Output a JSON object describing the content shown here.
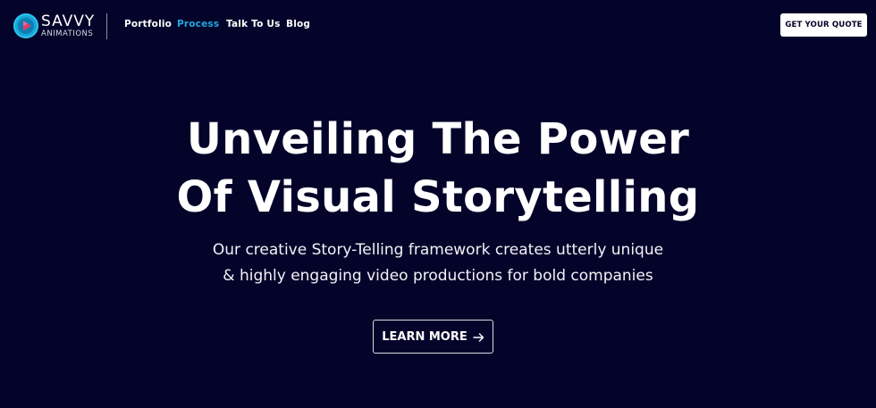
{
  "header": {
    "logo": {
      "name": "SAVVY",
      "tagline": "ANIMATIONS",
      "icon": "play-icon",
      "color": "#16a6d8"
    },
    "nav": [
      {
        "label": "Portfolio",
        "active": false
      },
      {
        "label": "Process",
        "active": true
      },
      {
        "label": "Talk To Us",
        "active": false
      },
      {
        "label": "Blog",
        "active": false
      }
    ],
    "cta_label": "GET YOUR QUOTE"
  },
  "hero": {
    "title_line1": "Unveiling The Power",
    "title_line2": "Of Visual Storytelling",
    "subtitle_line1": "Our creative Story-Telling framework creates utterly unique",
    "subtitle_line2": "& highly engaging video productions for bold companies",
    "button_label": "LEARN MORE",
    "button_icon": "arrow-right-icon"
  },
  "colors": {
    "background": "#04042a",
    "accent": "#1fa8e0",
    "text": "#ffffff"
  }
}
